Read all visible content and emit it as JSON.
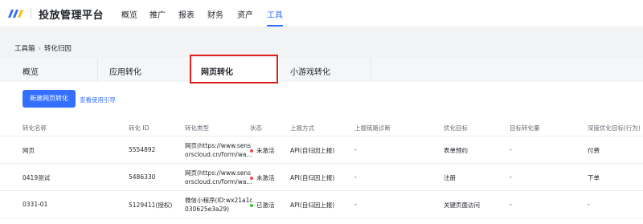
{
  "header": {
    "app_title": "投放管理平台",
    "nav": [
      {
        "label": "概览",
        "active": false
      },
      {
        "label": "推广",
        "active": false
      },
      {
        "label": "报表",
        "active": false
      },
      {
        "label": "财务",
        "active": false
      },
      {
        "label": "资产",
        "active": false
      },
      {
        "label": "工具",
        "active": true
      }
    ],
    "accent_color": "#3370ff"
  },
  "breadcrumb": {
    "items": [
      "工具箱",
      "转化归因"
    ],
    "separator": "›"
  },
  "tabs": [
    {
      "label": "概览",
      "active": false
    },
    {
      "label": "应用转化",
      "active": false
    },
    {
      "label": "网页转化",
      "active": true
    },
    {
      "label": "小游戏转化",
      "active": false
    }
  ],
  "toolbar": {
    "new_button": "新建网页转化",
    "guide_link": "查看使用引导"
  },
  "table": {
    "columns": [
      "转化名称",
      "转化 ID",
      "转化类型",
      "状态",
      "上报方式",
      "上报链路诊断",
      "优化目标",
      "目标转化量",
      "深度优化目标(行为)"
    ],
    "rows": [
      {
        "name": "网页",
        "id": "5554892",
        "type_line1": "网页(https://www.sens",
        "type_line2": "orscloud.cn/form/wa...",
        "status": "未激活",
        "status_color": "#f54a45",
        "report": "API(自归因上报)",
        "diagnosis": "-",
        "goal": "表单预约",
        "target": "-",
        "deep_goal": "付费"
      },
      {
        "name": "0419测试",
        "id": "5486330",
        "type_line1": "网页(https://www.sens",
        "type_line2": "orscloud.cn/form/wa...",
        "status": "未激活",
        "status_color": "#f54a45",
        "report": "API(自归因上报)",
        "diagnosis": "-",
        "goal": "注册",
        "target": "-",
        "deep_goal": "下单"
      },
      {
        "name": "0331-01",
        "id": "5129411(授权)",
        "type_line1": "微信小程序(ID:wx21a1c",
        "type_line2": "030625e3a29)",
        "status": "已激活",
        "status_color": "#34c724",
        "report": "API(自归因上报)",
        "diagnosis": "-",
        "goal": "关键页面访问",
        "target": "-",
        "deep_goal": "-"
      }
    ]
  }
}
